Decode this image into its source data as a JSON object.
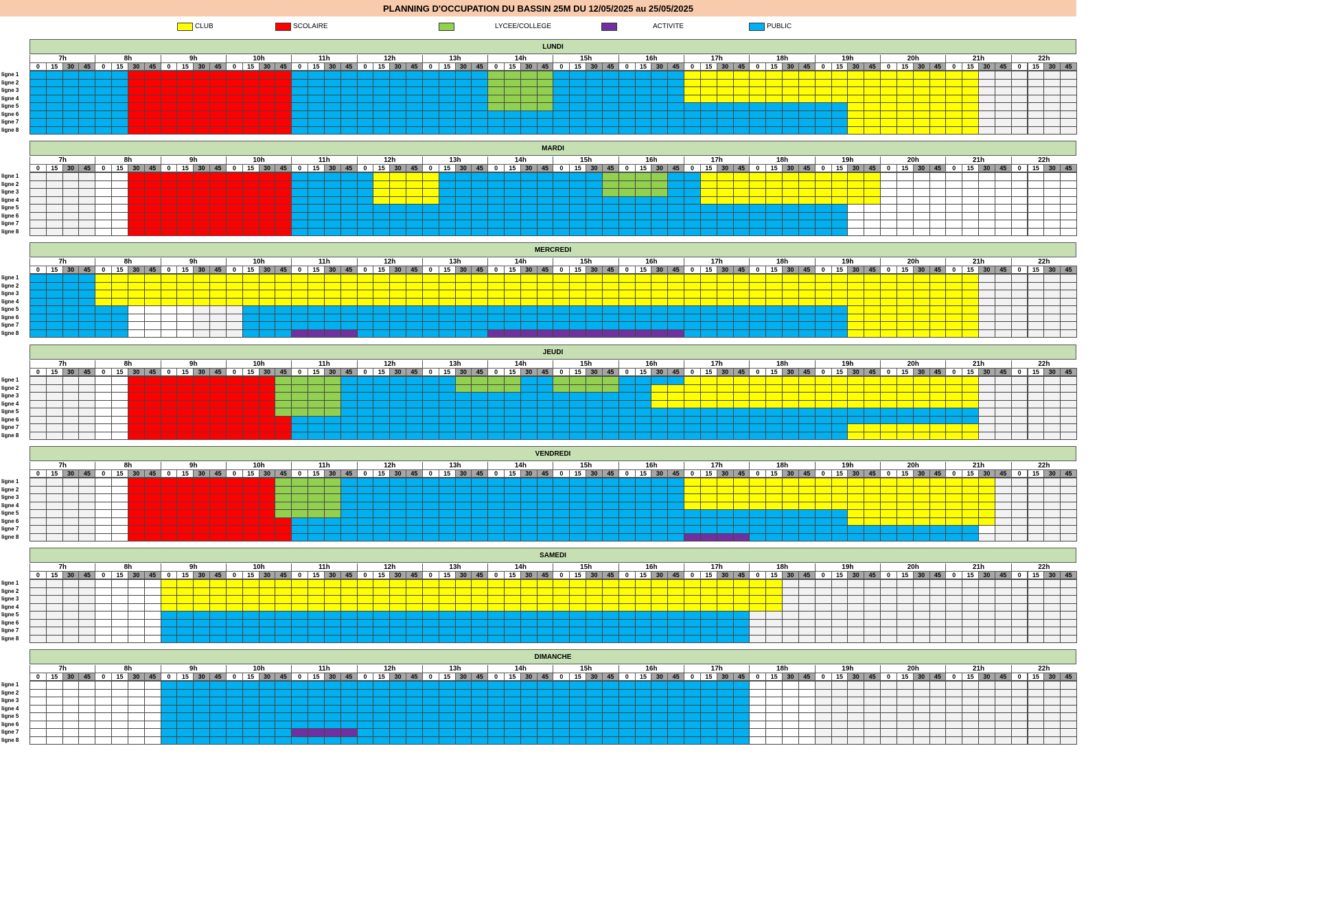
{
  "title": "PLANNING D'OCCUPATION DU BASSIN 25M DU 12/05/2025 au 25/05/2025",
  "legend": [
    {
      "key": "C",
      "label": "CLUB",
      "color": "#ffff00"
    },
    {
      "key": "S",
      "label": "SCOLAIRE",
      "color": "#ff0000"
    },
    {
      "key": "L",
      "label": "LYCEE/COLLEGE",
      "color": "#92d050"
    },
    {
      "key": "A",
      "label": "ACTIVITE",
      "color": "#7030a0"
    },
    {
      "key": "P",
      "label": "PUBLIC",
      "color": "#00b0f0"
    }
  ],
  "empty_colors": {
    "W": "#ffffff",
    "G": "#f2f2f2"
  },
  "hours": [
    "7h",
    "8h",
    "9h",
    "10h",
    "11h",
    "12h",
    "13h",
    "14h",
    "15h",
    "16h",
    "17h",
    "18h",
    "19h",
    "20h",
    "21h",
    "22h"
  ],
  "minutes": [
    "0",
    "15",
    "30",
    "45"
  ],
  "lanes": [
    "ligne 1",
    "ligne 2",
    "ligne 3",
    "ligne 4",
    "ligne 5",
    "ligne 6",
    "ligne 7",
    "ligne 8"
  ],
  "days": [
    {
      "name": "LUNDI",
      "rows": [
        "PPPPPPSSSSSSSSSSPPPPPPPPPPPPLLLLPPPPPPPPCCCCCCCCCCCCCCCCCCGGGGGG",
        "PPPPPPSSSSSSSSSSPPPPPPPPPPPPLLLLPPPPPPPPCCCCCCCCCCCCCCCCCCGGGGGG",
        "PPPPPPSSSSSSSSSSPPPPPPPPPPPPLLLLPPPPPPPPCCCCCCCCCCCCCCCCCCGGGGGG",
        "PPPPPPSSSSSSSSSSPPPPPPPPPPPPLLLLPPPPPPPPCCCCCCCCCCCCCCCCCCGGGGGG",
        "PPPPPPSSSSSSSSSSPPPPPPPPPPPPLLLLPPPPPPPPPPPPPPPPPPCCCCCCCCGGGGGG",
        "PPPPPPSSSSSSSSSSPPPPPPPPPPPPPPPPPPPPPPPPPPPPPPPPPPCCCCCCCCGGGGGG",
        "PPPPPPSSSSSSSSSSPPPPPPPPPPPPPPPPPPPPPPPPPPPPPPPPPPCCCCCCCCGGGGGG",
        "PPPPPPSSSSSSSSSSPPPPPPPPPPPPPPPPPPPPPPPPPPPPPPPPPPCCCCCCCCGGGGGG"
      ]
    },
    {
      "name": "MARDI",
      "rows": [
        "GGGGWWSSSSSSSSSSPPPPPCCCCPPPPPPPPPPLLLLPPCCCCCCCCCCCWWWWWWWWWWWW",
        "GGGGWWSSSSSSSSSSPPPPPCCCCPPPPPPPPPPLLLLPPCCCCCCCCCCCWWWWWWWWWWWW",
        "GGGGWWSSSSSSSSSSPPPPPCCCCPPPPPPPPPPLLLLPPCCCCCCCCCCCWWWWWWWWWWWW",
        "GGGGWWSSSSSSSSSSPPPPPCCCCPPPPPPPPPPPPPPPPCCCCCCCCCCCWWWWWWWWWWWW",
        "GGGGWWSSSSSSSSSSPPPPPPPPPPPPPPPPPPPPPPPPPPPPPPPPPPWWWWWWWWWWWWWW",
        "GGGGWWSSSSSSSSSSPPPPPPPPPPPPPPPPPPPPPPPPPPPPPPPPPPWWWWWWWWWWWWWW",
        "GGGGWWSSSSSSSSSSPPPPPPPPPPPPPPPPPPPPPPPPPPPPPPPPPPWWWWWWWWWWWWWW",
        "GGGGWWSSSSSSSSSSPPPPPPPPPPPPPPPPPPPPPPPPPPPPPPPPPPWWWWWWWWWWWWWW"
      ]
    },
    {
      "name": "MERCREDI",
      "rows": [
        "PPPPCCCCCCCCCCCCCCCCCCCCCCCCCCCCCCCCCCCCCCCCCCCCCCCCCCCCCCGGGGGG",
        "PPPPCCCCCCCCCCCCCCCCCCCCCCCCCCCCCCCCCCCCCCCCCCCCCCCCCCCCCCGGGGGG",
        "PPPPCCCCCCCCCCCCCCCCCCCCCCCCCCCCCCCCCCCCCCCCCCCCCCCCCCCCCCGGGGGG",
        "PPPPCCCCCCCCCCCCCCCCCCCCCCCCCCCCCCCCCCCCCCCCCCCCCCCCCCCCCCGGGGGG",
        "PPPPPPWWWWGGGPPPPPPPPPPPPPPPPPPPPPPPPPPPPPPPPPPPPPCCCCCCCCGGGGGG",
        "PPPPPPWWWWGGGPPPPPPPPPPPPPPPPPPPPPPPPPPPPPPPPPPPPPCCCCCCCCGGGGGG",
        "PPPPPPWWWWGGGPPPPPPPPPPPPPPPPPPPPPPPPPPPPPPPPPPPPPCCCCCCCCGGGGGG",
        "PPPPPPWWWWGGGPPPAAAAPPPPPPPPAAAAAAAAAAAAPPPPPPPPPPCCCCCCCCGGGGGG"
      ]
    },
    {
      "name": "JEUDI",
      "rows": [
        "GGGGWWSSSSSSSSSLLLLPPPPPPPLLLLPPLLLLPPPPCCCCCCCCCCCCCCCCCCGGGGGG",
        "GGGGWWSSSSSSSSSLLLLPPPPPPPLLLLPPLLLLPPCCCCCCCCCCCCCCCCCCCCGGGGGG",
        "GGGGWWSSSSSSSSSLLLLPPPPPPPPPPPPPPPPPPPCCCCCCCCCCCCCCCCCCCCGGGGGG",
        "GGGGWWSSSSSSSSSLLLLPPPPPPPPPPPPPPPPPPPCCCCCCCCCCCCCCCCCCCCGGGGGG",
        "GGGGWWSSSSSSSSSLLLLPPPPPPPPPPPPPPPPPPPPPPPPPPPPPPPPPPPPPPPGGGGGG",
        "GGGGWWSSSSSSSSSSPPPPPPPPPPPPPPPPPPPPPPPPPPPPPPPPPPPPPPPPPPGGGGGG",
        "GGGGWWSSSSSSSSSSPPPPPPPPPPPPPPPPPPPPPPPPPPPPPPPPPPCCCCCCCCGGGGGG",
        "GGGGWWSSSSSSSSSSPPPPPPPPPPPPPPPPPPPPPPPPPPPPPPPPPPCCCCCCCCGGGGGG"
      ]
    },
    {
      "name": "VENDREDI",
      "rows": [
        "GGGGWWSSSSSSSSSLLLLPPPPPPPPPPPPPPPPPPPPPCCCCCCCCCCCCCCCCCCCGGGGG",
        "GGGGWWSSSSSSSSSLLLLPPPPPPPPPPPPPPPPPPPPPCCCCCCCCCCCCCCCCCCCGGGGG",
        "GGGGWWSSSSSSSSSLLLLPPPPPPPPPPPPPPPPPPPPPCCCCCCCCCCCCCCCCCCCGGGGG",
        "GGGGWWSSSSSSSSSLLLLPPPPPPPPPPPPPPPPPPPPPCCCCCCCCCCCCCCCCCCCGGGGG",
        "GGGGWWSSSSSSSSSLLLLPPPPPPPPPPPPPPPPPPPPPPPPPPPPPPPCCCCCCCCCGGGGG",
        "GGGGWWSSSSSSSSSSPPPPPPPPPPPPPPPPPPPPPPPPPPPPPPPPPPCCCCCCCCCGGGGG",
        "GGGGWWSSSSSSSSSSPPPPPPPPPPPPPPPPPPPPPPPPPPPPPPPPPPPPPPPPPPWGGGGG",
        "GGGGWWSSSSSSSSSSPPPPPPPPPPPPPPPPPPPPPPPPAAAAPPPPPPPPPPPPPPGGGGGG"
      ]
    },
    {
      "name": "SAMEDI",
      "rows": [
        "GGGGWWWWCCCCCCCCCCCCCCCCCCCCCCCCCCCCCCCCCCCCCCGGGGGGGGGGGGGGGGGG",
        "GGGGWWWWCCCCCCCCCCCCCCCCCCCCCCCCCCCCCCCCCCCCCCGGGGGGGGGGGGGGGGGG",
        "GGGGWWWWCCCCCCCCCCCCCCCCCCCCCCCCCCCCCCCCCCCCCCGGGGGGGGGGGGGGGGGG",
        "GGGGWWWWCCCCCCCCCCCCCCCCCCCCCCCCCCCCCCCCCCCCCCGGGGGGGGGGGGGGGGGG",
        "GGGGWWWWPPPPPPPPPPPPPPPPPPPPPPPPPPPPPPPPPPPPGGGGGGGGGGGGGGGGGGGG",
        "GGGGWWWWPPPPPPPPPPPPPPPPPPPPPPPPPPPPPPPPPPPPGGGGGGGGGGGGGGGGGGGG",
        "GGGGWWWWPPPPPPPPPPPPPPPPPPPPPPPPPPPPPPPPPPPPGGGGGGGGGGGGGGGGGGGG",
        "GGGGWWWWPPPPPPPPPPPPPPPPPPPPPPPPPPPPPPPPPPPPGGGGGGGGGGGGGGGGGGGG"
      ]
    },
    {
      "name": "DIMANCHE",
      "rows": [
        "WWWWWWWWPPPPPPPPPPPPPPPPPPPPPPPPPPPPPPPPPPPPWWWWGGGGGGGGGGGGGGGG",
        "WWWWWWWWPPPPPPPPPPPPPPPPPPPPPPPPPPPPPPPPPPPPWWWWGGGGGGGGGGGGGGGG",
        "WWWWWWWWPPPPPPPPPPPPPPPPPPPPPPPPPPPPPPPPPPPPWWWWGGGGGGGGGGGGGGGG",
        "WWWWWWWWPPPPPPPPPPPPPPPPPPPPPPPPPPPPPPPPPPPPWWWWGGGGGGGGGGGGGGGG",
        "WWWWWWWWPPPPPPPPPPPPPPPPPPPPPPPPPPPPPPPPPPPPWWWWGGGGGGGGGGGGGGGG",
        "WWWWWWWWPPPPPPPPPPPPPPPPPPPPPPPPPPPPPPPPPPPPWWWWGGGGGGGGGGGGGGGG",
        "WWWWWWWWPPPPPPPPAAAAPPPPPPPPPPPPPPPPPPPPPPPPWWWWGGGGGGGGGGGGGGGG",
        "WWWWWWWWPPPPPPPPPPPPPPPPPPPPPPPPPPPPPPPPPPPPWWWWGGGGGGGGGGGGGGGG"
      ]
    }
  ]
}
